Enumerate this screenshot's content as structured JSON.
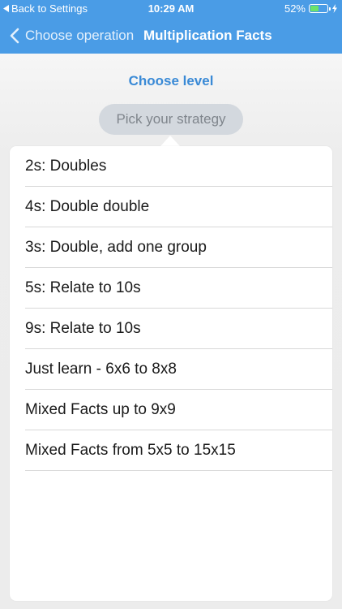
{
  "status_bar": {
    "back_label": "Back to Settings",
    "time": "10:29 AM",
    "battery_percent": "52%",
    "battery_level": 0.52
  },
  "nav": {
    "back_label": "Choose operation",
    "title": "Multiplication Facts"
  },
  "level_link": "Choose level",
  "strategy_button": "Pick your strategy",
  "options": [
    "2s: Doubles",
    "4s: Double double",
    "3s: Double, add one group",
    "5s: Relate to 10s",
    "9s: Relate to 10s",
    "Just learn - 6x6 to 8x8",
    "Mixed Facts up to 9x9",
    "Mixed Facts from 5x5 to 15x15"
  ],
  "colors": {
    "accent": "#4a9ce6",
    "link": "#3a8ad6",
    "battery": "#6be36b"
  }
}
